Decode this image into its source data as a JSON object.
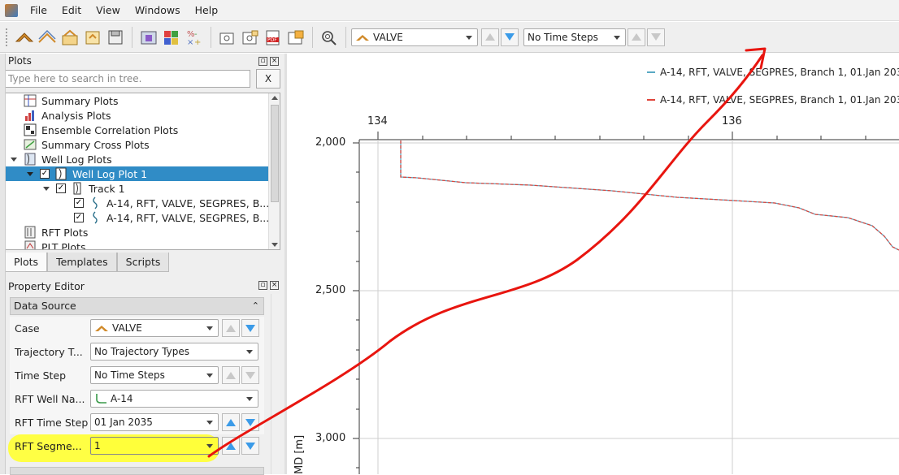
{
  "menu": [
    "File",
    "Edit",
    "View",
    "Windows",
    "Help"
  ],
  "toolbar": {
    "case_value": "VALVE",
    "time_steps_value": "No Time Steps"
  },
  "plots_panel": {
    "title": "Plots",
    "search_placeholder": "Type here to search in tree.",
    "clear_label": "X",
    "tree": [
      {
        "label": "Summary Plots",
        "icon": "summary-plots-icon"
      },
      {
        "label": "Analysis Plots",
        "icon": "analysis-plots-icon"
      },
      {
        "label": "Ensemble Correlation Plots",
        "icon": "ensemble-plots-icon"
      },
      {
        "label": "Summary Cross Plots",
        "icon": "cross-plots-icon"
      },
      {
        "label": "Well Log Plots",
        "icon": "well-log-plots-icon"
      },
      {
        "label": "Well Log Plot 1",
        "icon": "well-log-plot-icon",
        "checked": "✓"
      },
      {
        "label": "Track 1",
        "icon": "track-icon",
        "checked": "✓"
      },
      {
        "label": "A-14, RFT, VALVE, SEGPRES, B...",
        "icon": "curve-icon",
        "checked": "✓"
      },
      {
        "label": "A-14, RFT, VALVE, SEGPRES, B...",
        "icon": "curve-icon",
        "checked": "✓"
      },
      {
        "label": "RFT Plots",
        "icon": "rft-plots-icon"
      },
      {
        "label": "PLT Plots",
        "icon": "plt-plots-icon"
      }
    ],
    "tabs": [
      "Plots",
      "Templates",
      "Scripts"
    ]
  },
  "property_editor": {
    "title": "Property Editor",
    "group_title": "Data Source",
    "rows": [
      {
        "label": "Case",
        "value": "VALVE"
      },
      {
        "label": "Trajectory T...",
        "value": "No Trajectory Types"
      },
      {
        "label": "Time Step",
        "value": "No Time Steps"
      },
      {
        "label": "RFT Well Na...",
        "value": "A-14"
      },
      {
        "label": "RFT Time Step",
        "value": "01 Jan 2035"
      },
      {
        "label": "RFT Segme...",
        "value": "1"
      }
    ]
  },
  "plot": {
    "legend": [
      "A-14, RFT, VALVE, SEGPRES, Branch 1, 01.Jan 203",
      "A-14, RFT, VALVE, SEGPRES, Branch 1, 01.Jan 203"
    ],
    "x_ticks": [
      "134",
      "136"
    ],
    "y_ticks": [
      "2,000",
      "2,500",
      "3,000"
    ],
    "y_axis_label": "MD [m]"
  },
  "colors": {
    "selection": "#308cc6",
    "highlight": "#ffff3a",
    "annotation": "#e8150f",
    "curve_solid": "#5aa9c4",
    "curve_dashed": "#e0443a"
  }
}
